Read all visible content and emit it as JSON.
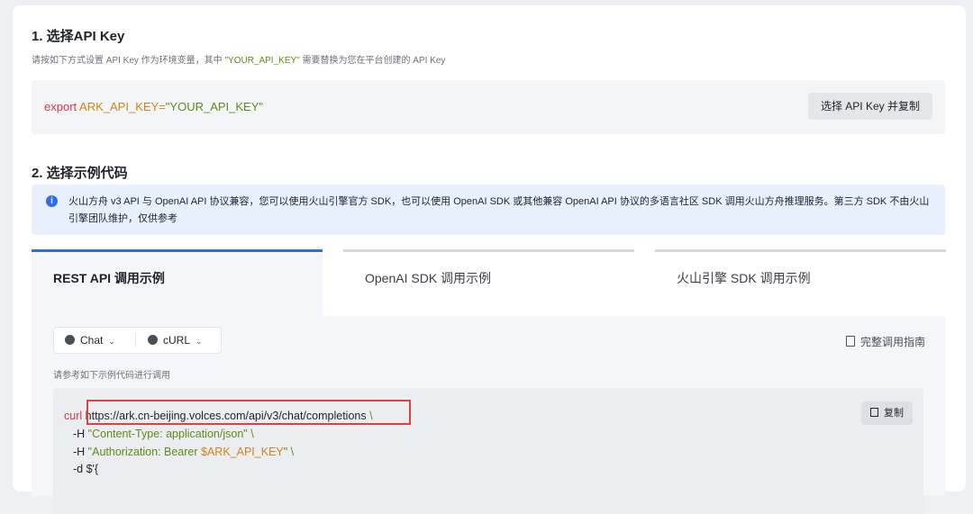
{
  "section1": {
    "title": "1. 选择API Key",
    "desc_prefix": "请按如下方式设置 API Key 作为环境变量，其中 ",
    "desc_key": "\"YOUR_API_KEY\"",
    "desc_suffix": " 需要替换为您在平台创建的 API Key",
    "export_kw": "export",
    "export_var": "ARK_API_KEY=",
    "export_val": "\"YOUR_API_KEY\"",
    "copy_button": "选择 API Key 并复制"
  },
  "section2": {
    "title": "2. 选择示例代码",
    "info_icon": "info-icon",
    "info_text": "火山方舟 v3 API 与 OpenAI API 协议兼容，您可以使用火山引擎官方 SDK，也可以使用 OpenAI SDK 或其他兼容 OpenAI API 协议的多语言社区 SDK 调用火山方舟推理服务。第三方 SDK 不由火山引擎团队维护，仅供参考"
  },
  "tabs": [
    {
      "label": "REST API 调用示例",
      "active": true
    },
    {
      "label": "OpenAI SDK 调用示例",
      "active": false
    },
    {
      "label": "火山引擎 SDK 调用示例",
      "active": false
    }
  ],
  "panel": {
    "select_chat": "Chat",
    "select_curl": "cURL",
    "guide_link": "完整调用指南",
    "hint": "请参考如下示例代码进行调用",
    "copy_button": "复制",
    "code": {
      "curl_kw": "curl",
      "url": "https://ark.cn-beijing.volces.com/api/v3/chat/completions",
      "line2_flag": "-H ",
      "line2_val": "\"Content-Type: application/json\"",
      "line3_flag": "-H ",
      "line3_val_a": "\"Authorization: Bearer ",
      "line3_val_b": "$ARK_API_KEY",
      "line3_val_c": "\"",
      "line4": "-d $'{",
      "backslash": " \\"
    }
  },
  "colors": {
    "accent": "#2f6de6",
    "keyword_red": "#d7354c",
    "keyword_orange": "#d08317",
    "string_green": "#5e8c1a",
    "highlight_border": "#d44545"
  }
}
